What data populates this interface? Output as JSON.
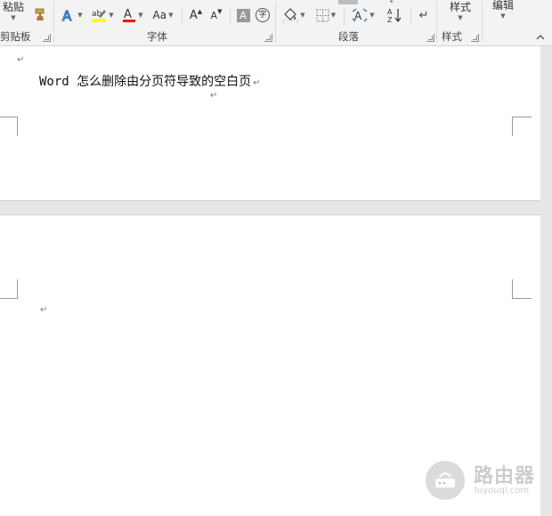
{
  "ribbon": {
    "clipboard": {
      "paste_label": "粘贴",
      "group_label": "剪贴板"
    },
    "font": {
      "group_label": "字体",
      "change_case_label": "Aa",
      "grow_font_label": "A",
      "shrink_font_label": "A",
      "char_shading_label": "A",
      "enclose_char_label": "字"
    },
    "paragraph": {
      "group_label": "段落"
    },
    "styles": {
      "styles_label": "样式",
      "group_label": "样式"
    },
    "editing": {
      "editing_label": "编辑"
    }
  },
  "colors": {
    "highlight": "#ffff00",
    "font_color": "#ff0000",
    "text_effect": "#2e75b6"
  },
  "document": {
    "title_line": "Word 怎么删除由分页符导致的空白页",
    "paragraph_mark": "↵"
  },
  "watermark": {
    "text": "路由器",
    "url": "luyouqi.com"
  }
}
